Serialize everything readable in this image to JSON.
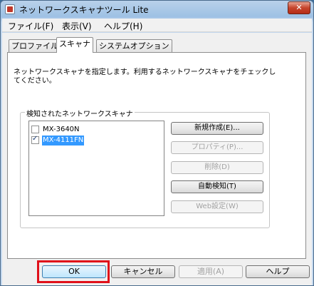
{
  "window": {
    "title": "ネットワークスキャナツール Lite",
    "close_label": "✕"
  },
  "menu": {
    "items": [
      "ファイル(F)",
      "表示(V)",
      "ヘルプ(H)"
    ]
  },
  "tabs": [
    {
      "label": "プロファイル",
      "active": false
    },
    {
      "label": "スキャナ",
      "active": true
    },
    {
      "label": "システムオプション",
      "active": false
    }
  ],
  "scanner_tab": {
    "description": "ネットワークスキャナを指定します。利用するネットワークスキャナをチェックしてください。",
    "group_title": "検知されたネットワークスキャナ",
    "scanners": [
      {
        "name": "MX-3640N",
        "checked": false,
        "selected": false
      },
      {
        "name": "MX-4111FN",
        "checked": true,
        "selected": true
      }
    ],
    "buttons": {
      "new": "新規作成(E)...",
      "properties": "プロパティ(P)...",
      "delete": "削除(D)",
      "auto_detect": "自動検知(T)",
      "web_settings": "Web設定(W)"
    }
  },
  "footer": {
    "ok": "OK",
    "cancel": "キャンセル",
    "apply": "適用(A)",
    "help": "ヘルプ"
  }
}
